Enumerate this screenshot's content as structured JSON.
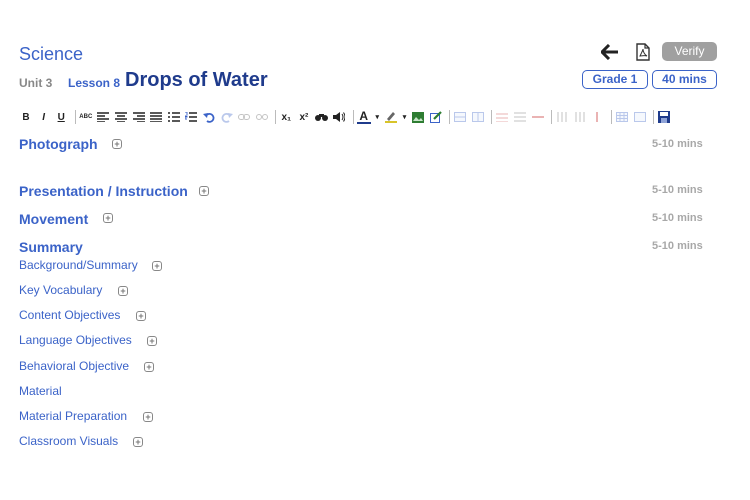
{
  "header": {
    "subject": "Science",
    "unit": "Unit 3",
    "lesson": "Lesson 8",
    "lesson_title": "Drops of Water",
    "verify_label": "Verify",
    "grade": "Grade 1",
    "duration": "40 mins"
  },
  "toolbar": {
    "bold": "B",
    "italic": "I",
    "underline": "U",
    "spellcheck": "ABC",
    "subscript": "x₁",
    "superscript": "x²",
    "font_color": "A"
  },
  "sections": [
    {
      "title": "Photograph",
      "time": "5-10 mins"
    },
    {
      "title": "Presentation / Instruction",
      "time": "5-10 mins"
    },
    {
      "title": "Movement",
      "time": "5-10 mins"
    },
    {
      "title": "Summary",
      "time": "5-10 mins"
    }
  ],
  "subsections": [
    {
      "label": "Background/Summary"
    },
    {
      "label": "Key Vocabulary"
    },
    {
      "label": "Content Objectives"
    },
    {
      "label": "Language Objectives"
    },
    {
      "label": "Behavioral Objective"
    },
    {
      "label": "Material"
    },
    {
      "label": "Material Preparation"
    },
    {
      "label": "Classroom Visuals"
    }
  ],
  "colors": {
    "accent": "#3b63c8",
    "title": "#1f3b8c",
    "muted": "#a8a8a8",
    "verify_bg": "#a0a0a0"
  }
}
